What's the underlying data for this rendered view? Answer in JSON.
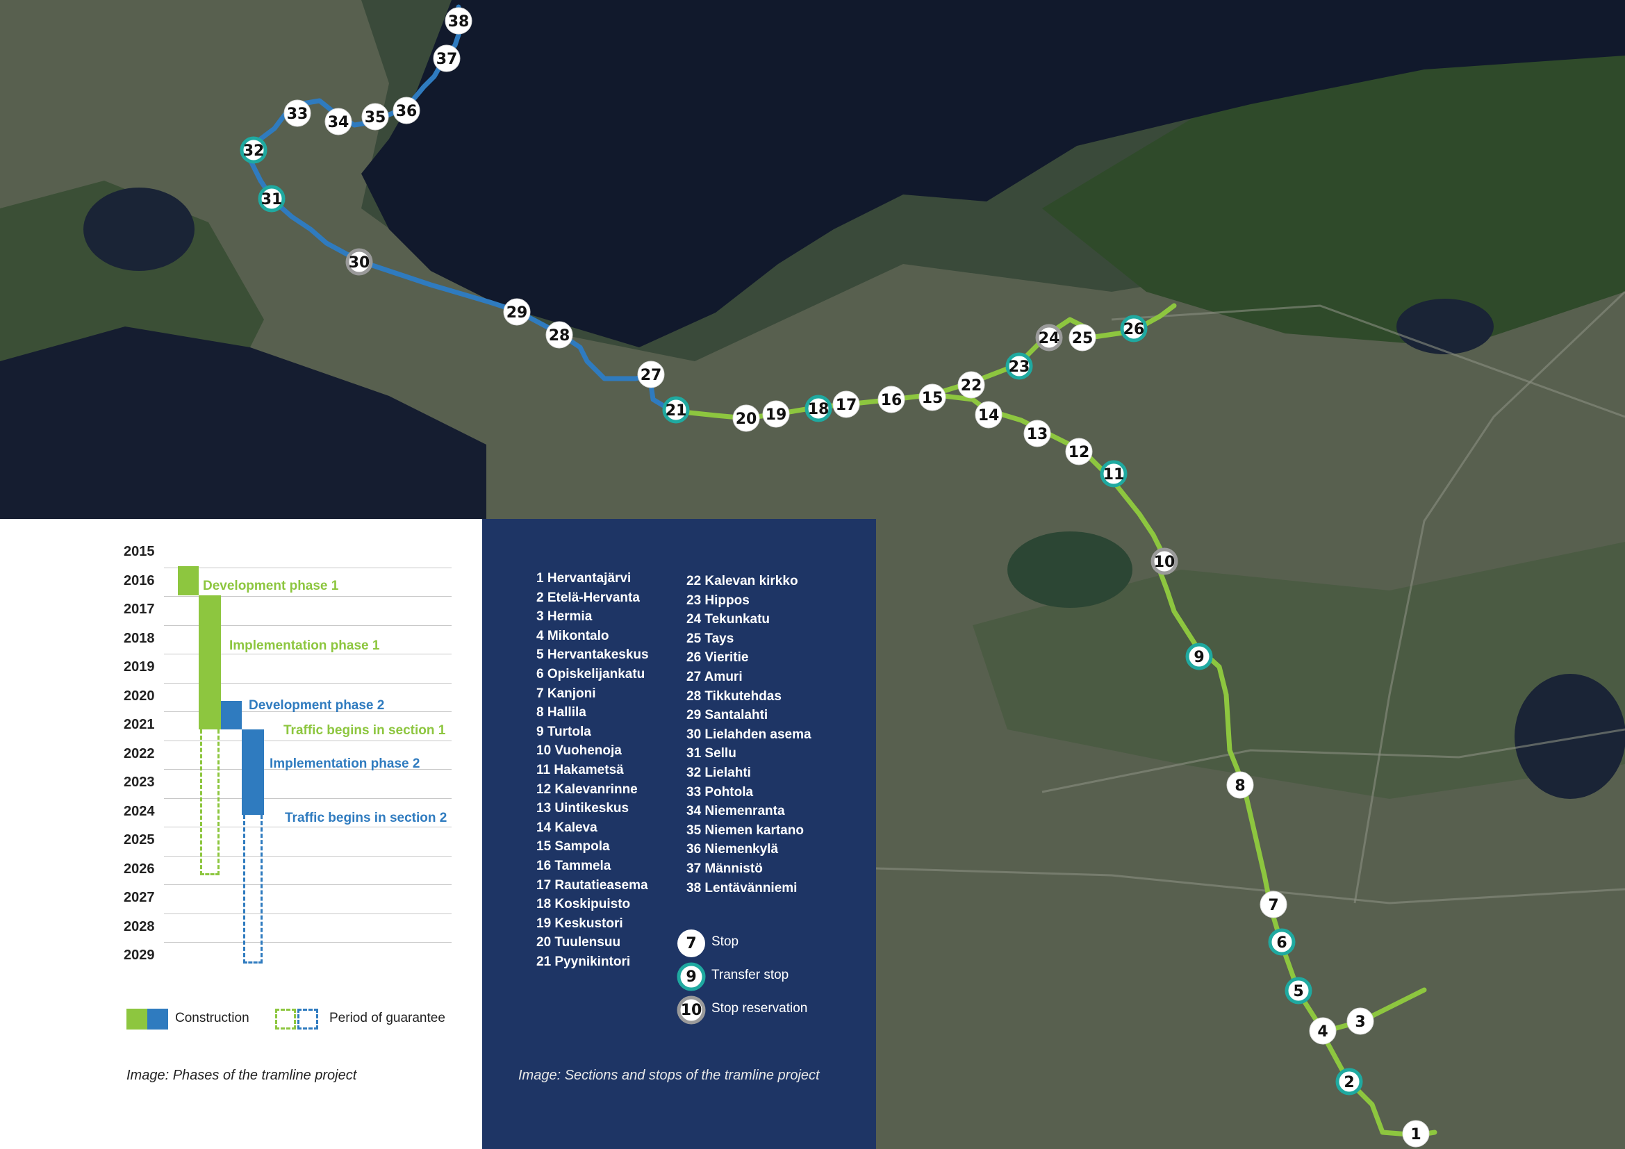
{
  "colors": {
    "green_line": "#8dc63f",
    "blue_line": "#2f7bbf",
    "stop_fill": "#ffffff",
    "transfer_ring": "#1fa9a0",
    "reservation_ring": "#9a9a9a",
    "panel_navy": "#1e3565"
  },
  "stops": [
    {
      "n": "1",
      "kind": "stop",
      "section": "green"
    },
    {
      "n": "2",
      "kind": "transfer",
      "section": "green"
    },
    {
      "n": "3",
      "kind": "stop",
      "section": "green"
    },
    {
      "n": "4",
      "kind": "stop",
      "section": "green"
    },
    {
      "n": "5",
      "kind": "transfer",
      "section": "green"
    },
    {
      "n": "6",
      "kind": "transfer",
      "section": "green"
    },
    {
      "n": "7",
      "kind": "stop",
      "section": "green"
    },
    {
      "n": "8",
      "kind": "stop",
      "section": "green"
    },
    {
      "n": "9",
      "kind": "transfer",
      "section": "green"
    },
    {
      "n": "10",
      "kind": "reservation",
      "section": "green"
    },
    {
      "n": "11",
      "kind": "transfer",
      "section": "green"
    },
    {
      "n": "12",
      "kind": "stop",
      "section": "green"
    },
    {
      "n": "13",
      "kind": "stop",
      "section": "green"
    },
    {
      "n": "14",
      "kind": "stop",
      "section": "green"
    },
    {
      "n": "15",
      "kind": "stop",
      "section": "green"
    },
    {
      "n": "16",
      "kind": "stop",
      "section": "green"
    },
    {
      "n": "17",
      "kind": "stop",
      "section": "green"
    },
    {
      "n": "18",
      "kind": "transfer",
      "section": "green"
    },
    {
      "n": "19",
      "kind": "stop",
      "section": "green"
    },
    {
      "n": "20",
      "kind": "stop",
      "section": "green"
    },
    {
      "n": "21",
      "kind": "transfer",
      "section": "green"
    },
    {
      "n": "22",
      "kind": "stop",
      "section": "green"
    },
    {
      "n": "23",
      "kind": "transfer",
      "section": "green"
    },
    {
      "n": "24",
      "kind": "reservation",
      "section": "green"
    },
    {
      "n": "25",
      "kind": "stop",
      "section": "green"
    },
    {
      "n": "26",
      "kind": "transfer",
      "section": "green"
    },
    {
      "n": "27",
      "kind": "stop",
      "section": "blue"
    },
    {
      "n": "28",
      "kind": "stop",
      "section": "blue"
    },
    {
      "n": "29",
      "kind": "stop",
      "section": "blue"
    },
    {
      "n": "30",
      "kind": "reservation",
      "section": "blue"
    },
    {
      "n": "31",
      "kind": "transfer",
      "section": "blue"
    },
    {
      "n": "32",
      "kind": "transfer",
      "section": "blue"
    },
    {
      "n": "33",
      "kind": "stop",
      "section": "blue"
    },
    {
      "n": "34",
      "kind": "stop",
      "section": "blue"
    },
    {
      "n": "35",
      "kind": "stop",
      "section": "blue"
    },
    {
      "n": "36",
      "kind": "stop",
      "section": "blue"
    },
    {
      "n": "37",
      "kind": "stop",
      "section": "blue"
    },
    {
      "n": "38",
      "kind": "stop",
      "section": "blue"
    }
  ],
  "timeline": {
    "years": [
      "2015",
      "2016",
      "2017",
      "2018",
      "2019",
      "2020",
      "2021",
      "2022",
      "2023",
      "2024",
      "2025",
      "2026",
      "2027",
      "2028",
      "2029"
    ],
    "phases": {
      "dev1": "Development phase 1",
      "impl1": "Implementation phase 1",
      "dev2": "Development phase 2",
      "traffic1": "Traffic begins in section  1",
      "impl2": "Implementation phase 2",
      "traffic2": "Traffic begins in section  2"
    },
    "legend": {
      "construction": "Construction",
      "guarantee": "Period of guarantee"
    },
    "caption": "Image: Phases of the tramline project"
  },
  "stop_list": {
    "col1": [
      "1 Hervantajärvi",
      "2 Etelä-Hervanta",
      "3 Hermia",
      "4 Mikontalo",
      "5 Hervantakeskus",
      "6 Opiskelijankatu",
      "7 Kanjoni",
      "8 Hallila",
      "9 Turtola",
      "10 Vuohenoja",
      "11 Hakametsä",
      "12 Kalevanrinne",
      "13 Uintikeskus",
      "14 Kaleva",
      "15 Sampola",
      "16 Tammela",
      "17 Rautatieasema",
      "18 Koskipuisto",
      "19 Keskustori",
      "20 Tuulensuu",
      "21 Pyynikintori"
    ],
    "col2": [
      "22 Kalevan kirkko",
      "23 Hippos",
      "24 Tekunkatu",
      "25 Tays",
      "26 Vieritie",
      "27 Amuri",
      "28 Tikkutehdas",
      "29 Santalahti",
      "30 Lielahden asema",
      "31 Sellu",
      "32 Lielahti",
      "33 Pohtola",
      "34 Niemenranta",
      "35 Niemen kartano",
      "36 Niemenkylä",
      "37 Männistö",
      "38 Lentävänniemi"
    ]
  },
  "marker_legend": {
    "stop": {
      "n": "7",
      "label": "Stop"
    },
    "transfer": {
      "n": "9",
      "label": "Transfer stop"
    },
    "reservation": {
      "n": "10",
      "label": "Stop reservation"
    }
  },
  "stops_caption": "Image: Sections and stops of the tramline project"
}
